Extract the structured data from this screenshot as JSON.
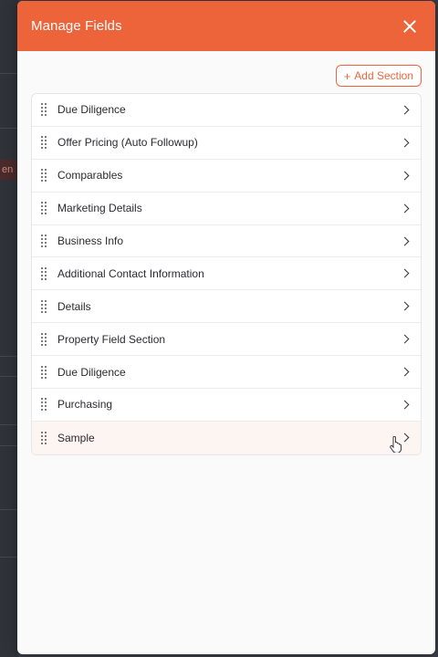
{
  "modal": {
    "title": "Manage Fields",
    "add_section_label": "Add Section"
  },
  "backdrop": {
    "tag_text": "en"
  },
  "sections": [
    {
      "label": "Due Diligence"
    },
    {
      "label": "Offer Pricing (Auto Followup)"
    },
    {
      "label": "Comparables"
    },
    {
      "label": "Marketing Details"
    },
    {
      "label": "Business Info"
    },
    {
      "label": "Additional Contact Information"
    },
    {
      "label": "Details"
    },
    {
      "label": "Property Field Section"
    },
    {
      "label": "Due Diligence"
    },
    {
      "label": "Purchasing"
    },
    {
      "label": "Sample"
    }
  ],
  "colors": {
    "accent": "#ee643a",
    "hover_row": "#fcf5f1"
  },
  "icons": {
    "close": "close-icon",
    "add": "plus-icon",
    "drag": "drag-handle-icon",
    "expand": "chevron-right-icon",
    "pointer": "hand-pointer-cursor-icon"
  }
}
